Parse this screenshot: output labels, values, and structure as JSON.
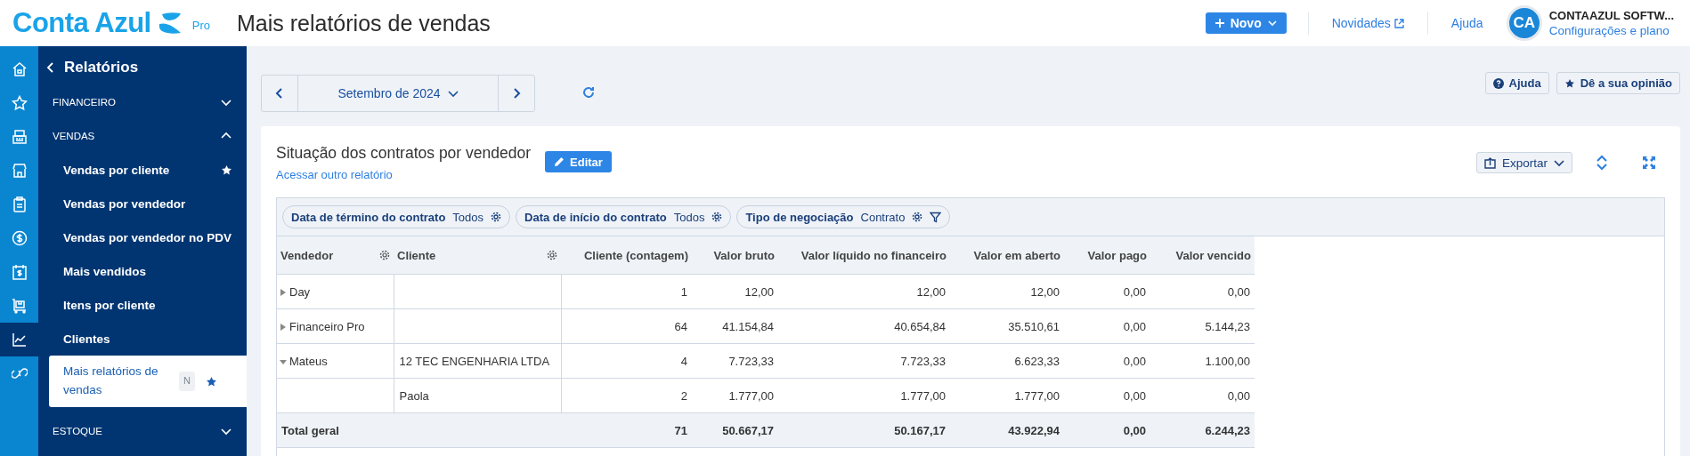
{
  "header": {
    "logo": "Conta Azul",
    "logo_badge": "Pro",
    "page_title": "Mais relatórios de vendas",
    "new_button": "Novo",
    "links": [
      {
        "label": "Novidades",
        "external": true
      },
      {
        "label": "Ajuda",
        "external": false
      }
    ],
    "account": {
      "initials": "CA",
      "name": "CONTAAZUL SOFTW...",
      "subtitle": "Configurações e plano"
    }
  },
  "rail": [
    {
      "kind": "home",
      "selected": false
    },
    {
      "kind": "star",
      "selected": false
    },
    {
      "kind": "register",
      "selected": false
    },
    {
      "kind": "store",
      "selected": false
    },
    {
      "kind": "clipboard",
      "selected": false
    },
    {
      "kind": "money",
      "selected": false
    },
    {
      "kind": "calendar",
      "selected": false
    },
    {
      "kind": "cart",
      "selected": false
    },
    {
      "kind": "chart",
      "selected": true
    },
    {
      "kind": "link",
      "selected": false
    }
  ],
  "sidebar": {
    "back": "Relatórios",
    "sections": [
      {
        "label": "FINANCEIRO",
        "expanded": false
      },
      {
        "label": "VENDAS",
        "expanded": true,
        "items": [
          {
            "label": "Vendas por cliente",
            "favorite": true,
            "selected": false
          },
          {
            "label": "Vendas por vendedor",
            "favorite": false,
            "selected": false
          },
          {
            "label": "Vendas por vendedor no PDV",
            "favorite": false,
            "selected": false
          },
          {
            "label": "Mais vendidos",
            "favorite": false,
            "selected": false
          },
          {
            "label": "Itens por cliente",
            "favorite": false,
            "selected": false
          },
          {
            "label": "Clientes",
            "favorite": false,
            "selected": false
          },
          {
            "label": "Mais relatórios de vendas",
            "favorite": true,
            "selected": true,
            "badge": "N"
          }
        ]
      },
      {
        "label": "ESTOQUE",
        "expanded": false
      }
    ]
  },
  "toolbar": {
    "period": "Setembro de 2024",
    "help_button": "Ajuda",
    "feedback_button": "Dê a sua opinião"
  },
  "report": {
    "title": "Situação dos contratos por vendedor",
    "switch_link": "Acessar outro relatório",
    "edit_button": "Editar",
    "export_button": "Exportar",
    "filters": [
      {
        "label": "Data de término do contrato",
        "value": "Todos",
        "filter_icon": false
      },
      {
        "label": "Data de início do contrato",
        "value": "Todos",
        "filter_icon": false
      },
      {
        "label": "Tipo de negociação",
        "value": "Contrato",
        "filter_icon": true
      }
    ],
    "columns": [
      {
        "label": "Vendedor",
        "settings": true
      },
      {
        "label": "Cliente",
        "settings": true
      },
      {
        "label": "Cliente (contagem)",
        "settings": false
      },
      {
        "label": "Valor bruto",
        "settings": false
      },
      {
        "label": "Valor líquido no financeiro",
        "settings": false
      },
      {
        "label": "Valor em aberto",
        "settings": false
      },
      {
        "label": "Valor pago",
        "settings": false
      },
      {
        "label": "Valor vencido",
        "settings": false
      }
    ],
    "groups": [
      {
        "vendedor": "Day",
        "expanded": false,
        "rows": [
          {
            "cells": [
              "1",
              "12,00",
              "12,00",
              "12,00",
              "0,00",
              "0,00"
            ]
          }
        ]
      },
      {
        "vendedor": "Financeiro Pro",
        "expanded": false,
        "rows": [
          {
            "cells": [
              "64",
              "41.154,84",
              "40.654,84",
              "35.510,61",
              "0,00",
              "5.144,23"
            ]
          }
        ]
      },
      {
        "vendedor": "Mateus",
        "expanded": true,
        "rows": [
          {
            "cliente": "12 TEC ENGENHARIA LTDA",
            "cells": [
              "4",
              "7.723,33",
              "7.723,33",
              "6.623,33",
              "0,00",
              "1.100,00"
            ]
          },
          {
            "cliente": "Paola",
            "cells": [
              "2",
              "1.777,00",
              "1.777,00",
              "1.777,00",
              "0,00",
              "0,00"
            ]
          }
        ]
      }
    ],
    "total": {
      "label": "Total geral",
      "cells": [
        "71",
        "50.667,17",
        "50.167,17",
        "43.922,94",
        "0,00",
        "6.244,23"
      ]
    }
  }
}
